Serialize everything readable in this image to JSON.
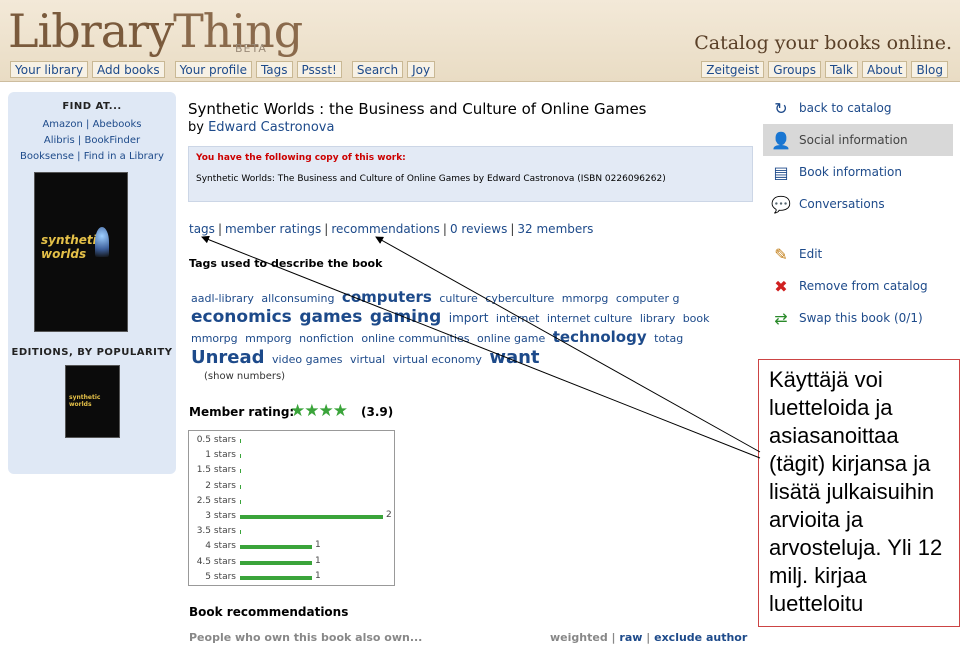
{
  "header": {
    "logo_library": "Library",
    "logo_thing": "Thing",
    "beta": "BETA",
    "tagline": "Catalog your books online.",
    "tabs_left": [
      "Your library",
      "Add books",
      "Your profile",
      "Tags",
      "Pssst!",
      "Search",
      "Joy"
    ],
    "tabs_right": [
      "Zeitgeist",
      "Groups",
      "Talk",
      "About",
      "Blog"
    ]
  },
  "sidebar": {
    "find_at": "FIND AT...",
    "link_line1": "Amazon | Abebooks",
    "link_line2": "Alibris | BookFinder",
    "link_line3": "Booksense | Find in a Library",
    "cover_title": "synthetic worlds",
    "editions_heading": "EDITIONS, BY POPULARITY"
  },
  "book": {
    "title": "Synthetic Worlds : the Business and Culture of Online Games",
    "by": "by",
    "author": "Edward Castronova",
    "copy_heading": "You have the following copy of this work:",
    "copy_text": "Synthetic Worlds: The Business and Culture of Online Games by Edward Castronova (ISBN 0226096262)"
  },
  "navlinks": [
    "tags",
    "member ratings",
    "recommendations",
    "0 reviews",
    "32 members"
  ],
  "tags": {
    "heading": "Tags used to describe the book",
    "cloud": [
      {
        "t": "aadl-library",
        "s": 1
      },
      {
        "t": "allconsuming",
        "s": 1
      },
      {
        "t": "computers",
        "s": 3
      },
      {
        "t": "culture",
        "s": 1
      },
      {
        "t": "cyberculture",
        "s": 1
      },
      {
        "t": "mmorpg",
        "s": 1
      },
      {
        "t": "computer g",
        "s": 1
      },
      {
        "t": "economics",
        "s": 4
      },
      {
        "t": "games",
        "s": 4
      },
      {
        "t": "gaming",
        "s": 4
      },
      {
        "t": "import",
        "s": 2
      },
      {
        "t": "internet",
        "s": 1
      },
      {
        "t": "internet culture",
        "s": 1
      },
      {
        "t": "library",
        "s": 1
      },
      {
        "t": "book",
        "s": 1
      },
      {
        "t": "mmorpg",
        "s": 1
      },
      {
        "t": "mmporg",
        "s": 1
      },
      {
        "t": "nonfiction",
        "s": 1
      },
      {
        "t": "online communities",
        "s": 1
      },
      {
        "t": "online game",
        "s": 1
      },
      {
        "t": "technology",
        "s": 3
      },
      {
        "t": "totag",
        "s": 1
      },
      {
        "t": "Unread",
        "s": 5
      },
      {
        "t": "video games",
        "s": 1
      },
      {
        "t": "virtual",
        "s": 1
      },
      {
        "t": "virtual economy",
        "s": 1
      },
      {
        "t": "want",
        "s": 5
      }
    ],
    "show_numbers": "(show numbers)"
  },
  "rating": {
    "heading": "Member rating:",
    "stars": "★★★★",
    "value": "(3.9)",
    "histogram": [
      {
        "label": "0.5 stars",
        "count": 0,
        "count_label": ""
      },
      {
        "label": "1 stars",
        "count": 0,
        "count_label": ""
      },
      {
        "label": "1.5 stars",
        "count": 0,
        "count_label": ""
      },
      {
        "label": "2 stars",
        "count": 0,
        "count_label": ""
      },
      {
        "label": "2.5 stars",
        "count": 0,
        "count_label": ""
      },
      {
        "label": "3 stars",
        "count": 2,
        "count_label": "2"
      },
      {
        "label": "3.5 stars",
        "count": 0,
        "count_label": ""
      },
      {
        "label": "4 stars",
        "count": 1,
        "count_label": "1"
      },
      {
        "label": "4.5 stars",
        "count": 1,
        "count_label": "1"
      },
      {
        "label": "5 stars",
        "count": 1,
        "count_label": "1"
      }
    ]
  },
  "recommendations": {
    "heading": "Book recommendations",
    "sub": "People who own this book also own...",
    "weighted": "weighted",
    "raw": "raw",
    "exclude": "exclude author"
  },
  "right_nav": [
    {
      "label": "back to catalog",
      "icon": "back-arrow-icon",
      "glyph": "↻",
      "selected": false
    },
    {
      "label": "Social information",
      "icon": "social-search-icon",
      "glyph": "👤",
      "selected": true
    },
    {
      "label": "Book information",
      "icon": "book-info-icon",
      "glyph": "▤",
      "selected": false
    },
    {
      "label": "Conversations",
      "icon": "speech-bubble-icon",
      "glyph": "💬",
      "selected": false
    },
    {
      "label": "",
      "icon": "",
      "glyph": "",
      "selected": false
    },
    {
      "label": "Edit",
      "icon": "pencil-icon",
      "glyph": "✎",
      "selected": false
    },
    {
      "label": "Remove from catalog",
      "icon": "remove-x-icon",
      "glyph": "✖",
      "selected": false
    },
    {
      "label": "Swap this book (0/1)",
      "icon": "swap-arrows-icon",
      "glyph": "⇄",
      "selected": false
    }
  ],
  "callout": {
    "text": "Käyttäjä voi luetteloida ja asiasanoittaa (tägit) kirjansa ja lisätä julkaisuihin arvioita ja arvosteluja. Yli 12 milj. kirjaa luetteloitu"
  }
}
